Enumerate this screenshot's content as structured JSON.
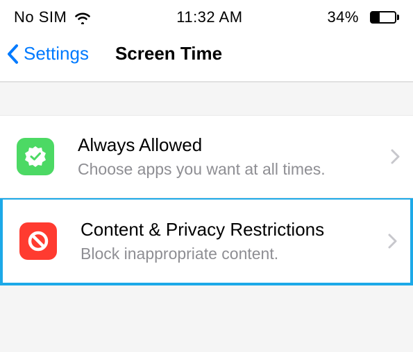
{
  "status_bar": {
    "sim": "No SIM",
    "time": "11:32 AM",
    "battery_pct": "34%",
    "battery_fill_width_pct": 34
  },
  "nav": {
    "back_label": "Settings",
    "title": "Screen Time"
  },
  "rows": {
    "always_allowed": {
      "title": "Always Allowed",
      "subtitle": "Choose apps you want at all times."
    },
    "content_privacy": {
      "title": "Content & Privacy Restrictions",
      "subtitle": "Block inappropriate content."
    }
  }
}
